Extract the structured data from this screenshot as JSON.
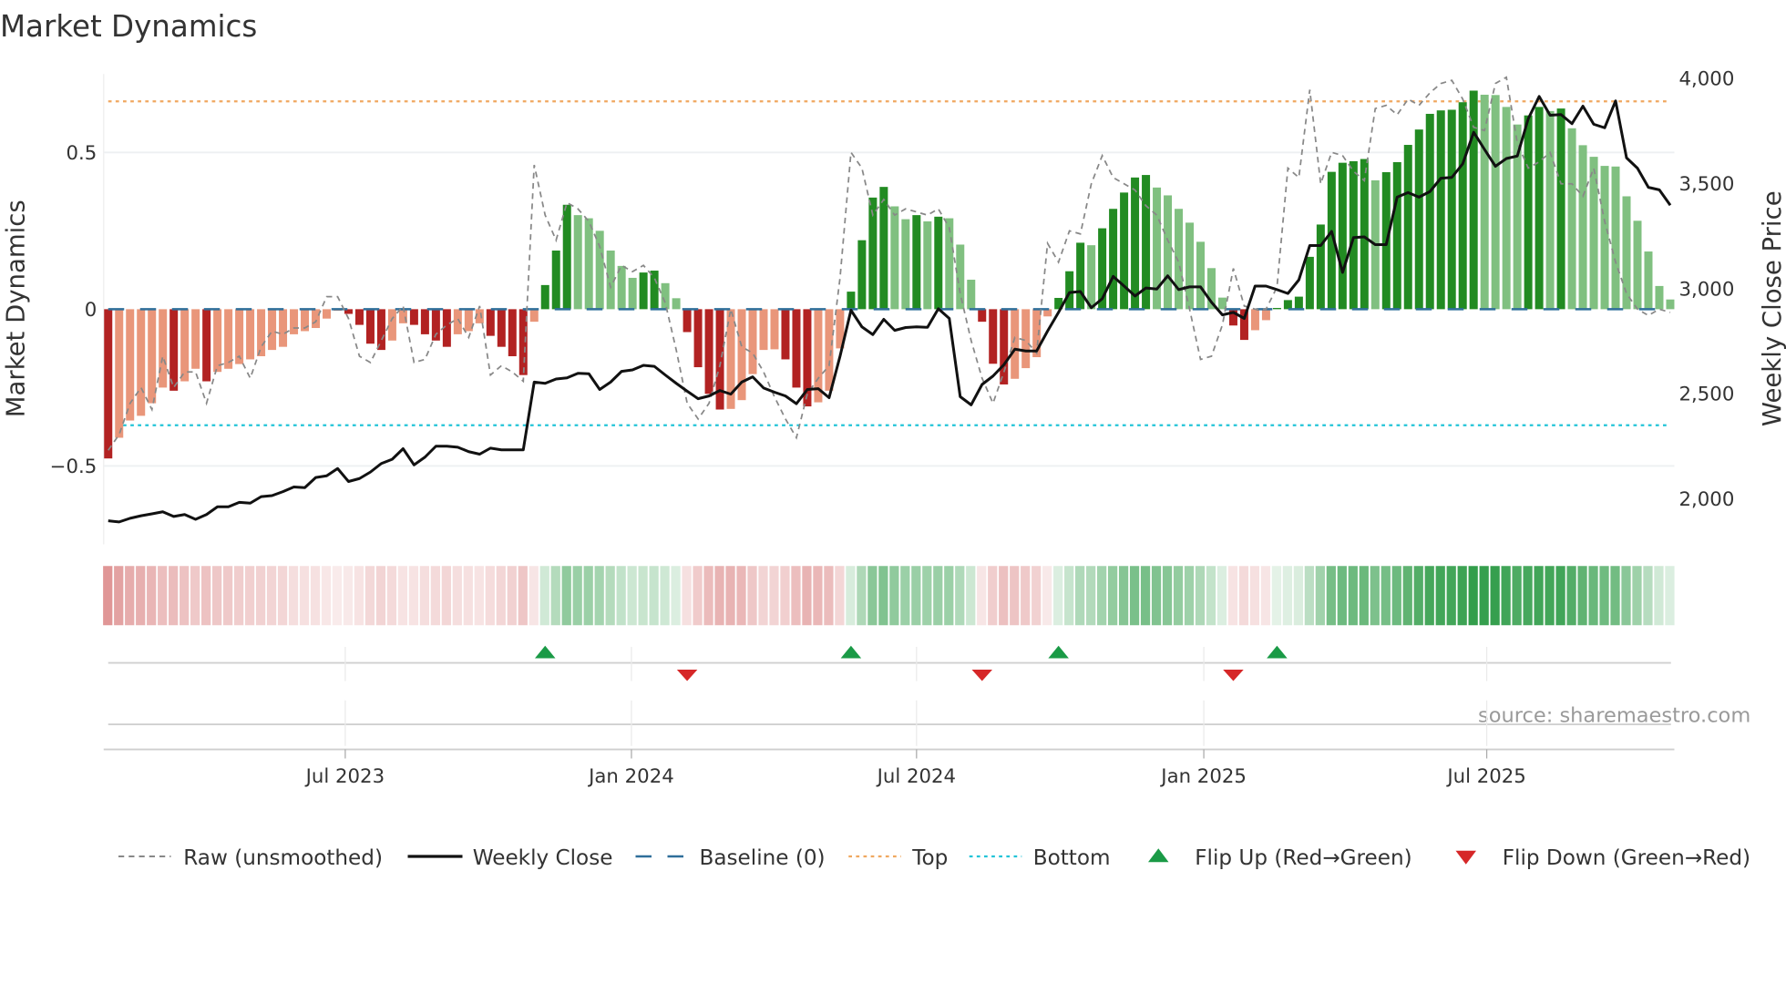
{
  "chart_data": {
    "type": "bar",
    "title": "Market Dynamics",
    "ylabel_left": "Market Dynamics",
    "ylabel_right": "Weekly Close Price",
    "ylim_left": [
      -0.75,
      0.75
    ],
    "ylim_right": [
      1778,
      4016
    ],
    "yticks_left": [
      {
        "v": 0.5,
        "label": "0.5"
      },
      {
        "v": 0,
        "label": "0"
      },
      {
        "v": -0.5,
        "label": "−0.5"
      }
    ],
    "yticks_right": [
      {
        "v": 4000,
        "label": "4,000"
      },
      {
        "v": 3500,
        "label": "3,500"
      },
      {
        "v": 3000,
        "label": "3,000"
      },
      {
        "v": 2500,
        "label": "2,500"
      },
      {
        "v": 2000,
        "label": "2,000"
      }
    ],
    "x_unit": "week index",
    "xticks": [
      {
        "week": 21.7,
        "label": "Jul 2023"
      },
      {
        "week": 47.9,
        "label": "Jan 2024"
      },
      {
        "week": 74.0,
        "label": "Jul 2024"
      },
      {
        "week": 100.3,
        "label": "Jan 2025"
      },
      {
        "week": 126.2,
        "label": "Jul 2025"
      }
    ],
    "levels": {
      "baseline": 0,
      "top": 0.663,
      "bottom": -0.37
    },
    "colors": {
      "pos_strong": "#228b22",
      "pos_weak": "#80c080",
      "neg_strong": "#b22222",
      "neg_weak": "#e9967a",
      "raw": "#888888",
      "close": "#111111",
      "baseline": "#2f6f9a",
      "top": "#f0a860",
      "bottom": "#22c4d8",
      "flip_up": "#1a9a46",
      "flip_down": "#d62728"
    },
    "series": [
      {
        "name": "Market Dynamics",
        "values": [
          -0.476,
          -0.41,
          -0.355,
          -0.34,
          -0.3,
          -0.25,
          -0.26,
          -0.23,
          -0.19,
          -0.23,
          -0.2,
          -0.19,
          -0.175,
          -0.16,
          -0.15,
          -0.13,
          -0.12,
          -0.08,
          -0.07,
          -0.06,
          -0.03,
          -0.005,
          -0.015,
          -0.05,
          -0.11,
          -0.13,
          -0.1,
          -0.045,
          -0.05,
          -0.08,
          -0.1,
          -0.12,
          -0.08,
          -0.07,
          -0.045,
          -0.085,
          -0.12,
          -0.15,
          -0.21,
          -0.04,
          0.077,
          0.187,
          0.333,
          0.3,
          0.29,
          0.25,
          0.187,
          0.138,
          0.1,
          0.117,
          0.123,
          0.083,
          0.035,
          -0.073,
          -0.185,
          -0.27,
          -0.32,
          -0.318,
          -0.29,
          -0.207,
          -0.13,
          -0.128,
          -0.16,
          -0.25,
          -0.31,
          -0.297,
          -0.26,
          -0.125,
          0.056,
          0.22,
          0.356,
          0.39,
          0.328,
          0.287,
          0.3,
          0.28,
          0.295,
          0.29,
          0.206,
          0.094,
          -0.04,
          -0.174,
          -0.24,
          -0.222,
          -0.188,
          -0.153,
          -0.023,
          0.036,
          0.121,
          0.212,
          0.204,
          0.258,
          0.32,
          0.372,
          0.42,
          0.428,
          0.388,
          0.363,
          0.32,
          0.276,
          0.215,
          0.131,
          0.037,
          -0.052,
          -0.098,
          -0.067,
          -0.035,
          0.004,
          0.029,
          0.04,
          0.167,
          0.27,
          0.438,
          0.467,
          0.472,
          0.479,
          0.411,
          0.437,
          0.469,
          0.524,
          0.573,
          0.623,
          0.634,
          0.636,
          0.66,
          0.697,
          0.684,
          0.683,
          0.645,
          0.589,
          0.618,
          0.645,
          0.632,
          0.64,
          0.577,
          0.523,
          0.486,
          0.457,
          0.455,
          0.36,
          0.282,
          0.184,
          0.074,
          0.031
        ]
      },
      {
        "name": "Raw (unsmoothed)",
        "values": [
          -0.45,
          -0.4,
          -0.3,
          -0.25,
          -0.32,
          -0.15,
          -0.25,
          -0.2,
          -0.2,
          -0.3,
          -0.18,
          -0.17,
          -0.15,
          -0.22,
          -0.12,
          -0.07,
          -0.08,
          -0.06,
          -0.06,
          -0.04,
          0.04,
          0.04,
          -0.03,
          -0.15,
          -0.17,
          -0.1,
          -0.03,
          0.01,
          -0.17,
          -0.16,
          -0.08,
          -0.05,
          -0.03,
          -0.09,
          0.01,
          -0.21,
          -0.18,
          -0.2,
          -0.23,
          0.46,
          0.3,
          0.22,
          0.34,
          0.32,
          0.28,
          0.2,
          0.07,
          0.14,
          0.12,
          0.14,
          0.1,
          0.02,
          -0.13,
          -0.3,
          -0.35,
          -0.3,
          -0.18,
          0.0,
          -0.12,
          -0.14,
          -0.2,
          -0.28,
          -0.35,
          -0.41,
          -0.27,
          -0.22,
          -0.18,
          0.1,
          0.5,
          0.45,
          0.3,
          0.35,
          0.3,
          0.32,
          0.31,
          0.3,
          0.32,
          0.26,
          0.05,
          -0.1,
          -0.22,
          -0.3,
          -0.2,
          -0.09,
          -0.1,
          -0.14,
          0.21,
          0.15,
          0.25,
          0.24,
          0.4,
          0.49,
          0.42,
          0.4,
          0.38,
          0.33,
          0.3,
          0.22,
          0.15,
          0.0,
          -0.16,
          -0.15,
          -0.05,
          0.13,
          0.01,
          0.0,
          0.0,
          0.07,
          0.45,
          0.42,
          0.7,
          0.4,
          0.5,
          0.49,
          0.44,
          0.41,
          0.64,
          0.65,
          0.62,
          0.67,
          0.65,
          0.69,
          0.72,
          0.73,
          0.67,
          0.58,
          0.57,
          0.72,
          0.74,
          0.53,
          0.45,
          0.47,
          0.5,
          0.4,
          0.4,
          0.36,
          0.45,
          0.28,
          0.15,
          0.05,
          0.0,
          -0.02,
          0.0,
          -0.01
        ]
      },
      {
        "name": "Weekly Close",
        "axis": "right",
        "values": [
          1890,
          1885,
          1902,
          1914,
          1923,
          1933,
          1911,
          1920,
          1897,
          1920,
          1957,
          1957,
          1978,
          1974,
          2005,
          2010,
          2029,
          2051,
          2048,
          2096,
          2104,
          2139,
          2077,
          2091,
          2122,
          2163,
          2183,
          2233,
          2156,
          2193,
          2245,
          2245,
          2240,
          2219,
          2207,
          2236,
          2228,
          2228,
          2228,
          2550,
          2544,
          2565,
          2570,
          2592,
          2590,
          2515,
          2550,
          2601,
          2608,
          2630,
          2625,
          2584,
          2544,
          2507,
          2471,
          2484,
          2510,
          2493,
          2550,
          2575,
          2522,
          2502,
          2484,
          2447,
          2515,
          2519,
          2476,
          2673,
          2892,
          2813,
          2776,
          2849,
          2796,
          2810,
          2813,
          2811,
          2899,
          2853,
          2481,
          2442,
          2539,
          2579,
          2633,
          2707,
          2698,
          2698,
          2793,
          2882,
          2976,
          2981,
          2904,
          2947,
          3053,
          3007,
          2960,
          2998,
          2993,
          3056,
          2990,
          3003,
          3003,
          2930,
          2870,
          2882,
          2853,
          3007,
          3007,
          2990,
          2972,
          3036,
          3200,
          3200,
          3267,
          3072,
          3238,
          3241,
          3204,
          3204,
          3430,
          3452,
          3430,
          3457,
          3520,
          3524,
          3589,
          3739,
          3657,
          3577,
          3614,
          3626,
          3803,
          3909,
          3820,
          3823,
          3780,
          3863,
          3777,
          3760,
          3888,
          3617,
          3568,
          3477,
          3465,
          3392
        ]
      }
    ],
    "flip_up_weeks": [
      40,
      68,
      87,
      107
    ],
    "flip_down_weeks": [
      53,
      80,
      103
    ],
    "legend": {
      "placement": "bottom",
      "items": [
        {
          "key": "raw",
          "label": "Raw (unsmoothed)"
        },
        {
          "key": "close",
          "label": "Weekly Close"
        },
        {
          "key": "baseline",
          "label": "Baseline (0)"
        },
        {
          "key": "top",
          "label": "Top"
        },
        {
          "key": "bottom",
          "label": "Bottom"
        },
        {
          "key": "flip_up",
          "label": "Flip Up (Red→Green)"
        },
        {
          "key": "flip_down",
          "label": "Flip Down (Green→Red)"
        }
      ]
    },
    "source": "source: sharemaestro.com"
  }
}
